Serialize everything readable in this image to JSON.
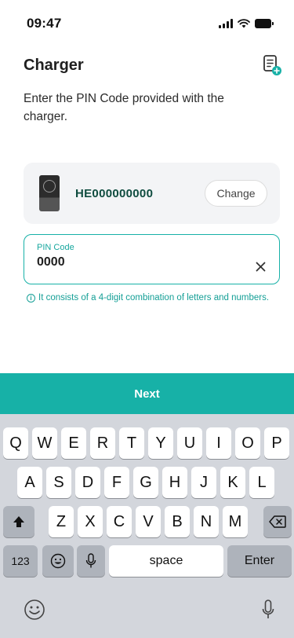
{
  "status_bar": {
    "time": "09:47"
  },
  "header": {
    "title": "Charger"
  },
  "subtitle": "Enter the PIN Code provided with the charger.",
  "charger": {
    "id": "HE000000000",
    "change_label": "Change"
  },
  "pin": {
    "label": "PIN Code",
    "value": "0000"
  },
  "hint": "It consists of a 4-digit combination of letters and numbers.",
  "next_label": "Next",
  "keyboard": {
    "row1": [
      "Q",
      "W",
      "E",
      "R",
      "T",
      "Y",
      "U",
      "I",
      "O",
      "P"
    ],
    "row2": [
      "A",
      "S",
      "D",
      "F",
      "G",
      "H",
      "J",
      "K",
      "L"
    ],
    "row3": [
      "Z",
      "X",
      "C",
      "V",
      "B",
      "N",
      "M"
    ],
    "numbers_label": "123",
    "space_label": "space",
    "enter_label": "Enter"
  },
  "colors": {
    "accent": "#17b1a7",
    "charger_id": "#0f4c3f",
    "keyboard_bg": "#d3d6dc"
  }
}
